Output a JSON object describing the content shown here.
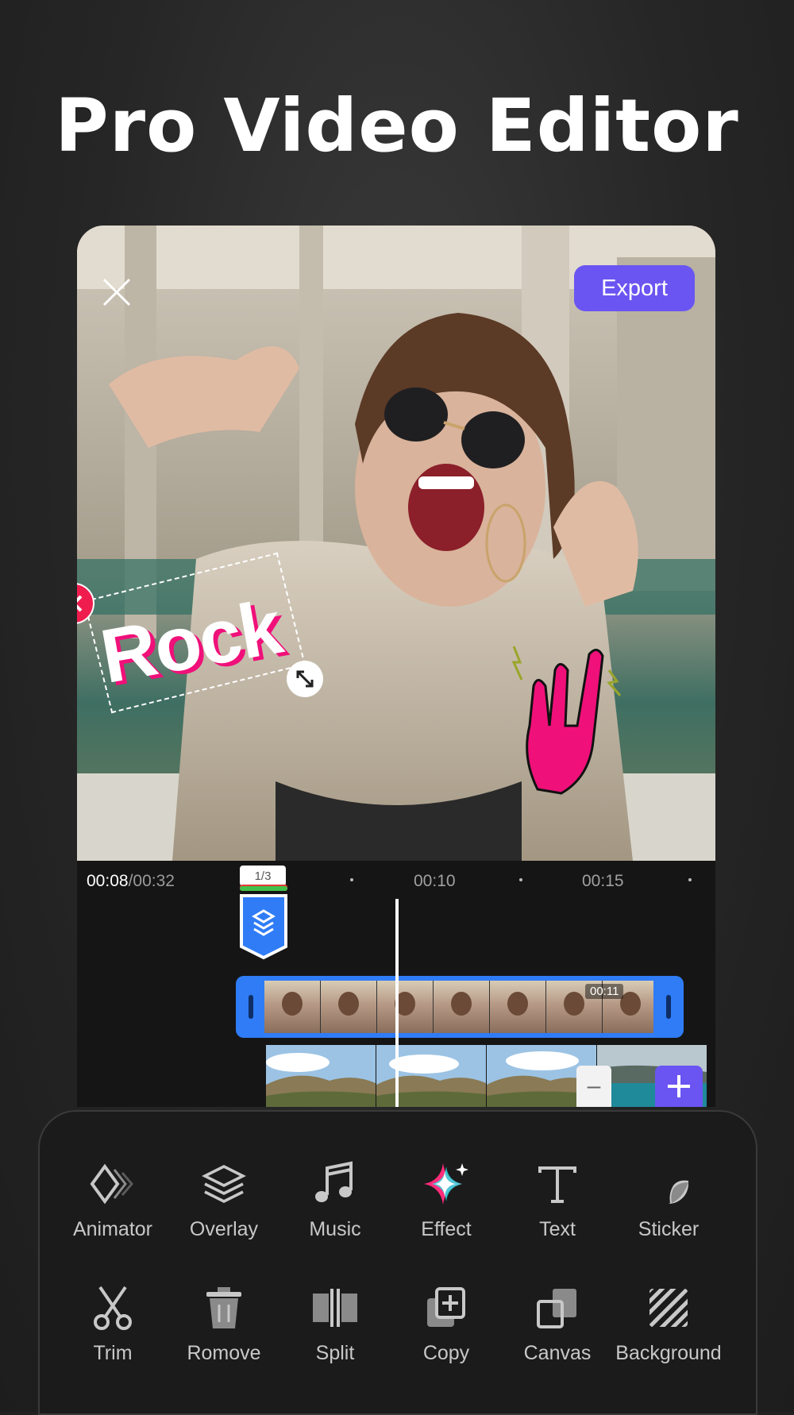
{
  "headline": "Pro Video Editor",
  "preview": {
    "export_label": "Export",
    "sticker_text": "Rock"
  },
  "timeline": {
    "current_time": "00:08",
    "total_time": "/00:32",
    "ticks": [
      "00:10",
      "00:15"
    ],
    "layer_badge": "1/3",
    "clip_duration": "00:11",
    "zoom_out": "–",
    "add_clip": "+"
  },
  "toolbar": {
    "row1": [
      "Animator",
      "Overlay",
      "Music",
      "Effect",
      "Text",
      "Sticker"
    ],
    "row2": [
      "Trim",
      "Romove",
      "Split",
      "Copy",
      "Canvas",
      "Background"
    ]
  },
  "colors": {
    "accent": "#6a55f2",
    "clip_blue": "#2f7cf6",
    "sticker_pink": "#f0107a",
    "delete_red": "#ef1c4e"
  },
  "icons": {
    "row1": [
      "animator-icon",
      "overlay-icon",
      "music-icon",
      "effect-icon",
      "text-icon",
      "sticker-icon"
    ],
    "row2": [
      "trim-icon",
      "remove-icon",
      "split-icon",
      "copy-icon",
      "canvas-icon",
      "background-icon"
    ]
  }
}
